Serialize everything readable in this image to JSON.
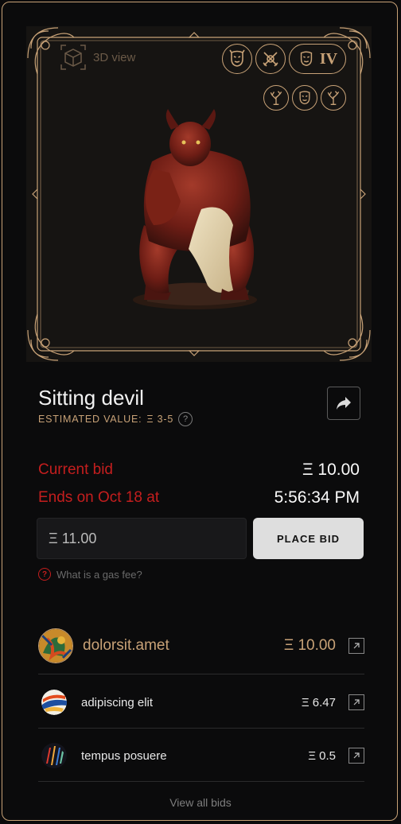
{
  "artwork": {
    "view3d_label": "3D view",
    "tier_badge": "IV",
    "icons": [
      "mask-icon",
      "crossed-swords-icon",
      "mask-icon",
      "tree-icon",
      "mask-icon",
      "tree-icon"
    ]
  },
  "item": {
    "title": "Sitting devil",
    "estimated_label": "ESTIMATED VALUE:",
    "estimated_value": "Ξ 3-5",
    "help_glyph": "?"
  },
  "auction": {
    "current_bid_label": "Current bid",
    "current_bid_value": "Ξ 10.00",
    "ends_label": "Ends on Oct 18 at",
    "ends_time": "5:56:34 PM"
  },
  "bid_form": {
    "input_value": "Ξ 11.00",
    "place_bid_label": "PLACE BID",
    "gas_fee_link": "What is a gas fee?"
  },
  "bids": [
    {
      "name": "dolorsit.amet",
      "amount": "Ξ 10.00"
    },
    {
      "name": "adipiscing elit",
      "amount": "Ξ 6.47"
    },
    {
      "name": "tempus posuere",
      "amount": "Ξ 0.5"
    }
  ],
  "view_all_label": "View all bids",
  "colors": {
    "gold": "#c8a277",
    "red": "#c41e1e",
    "background": "#0b0b0c"
  }
}
